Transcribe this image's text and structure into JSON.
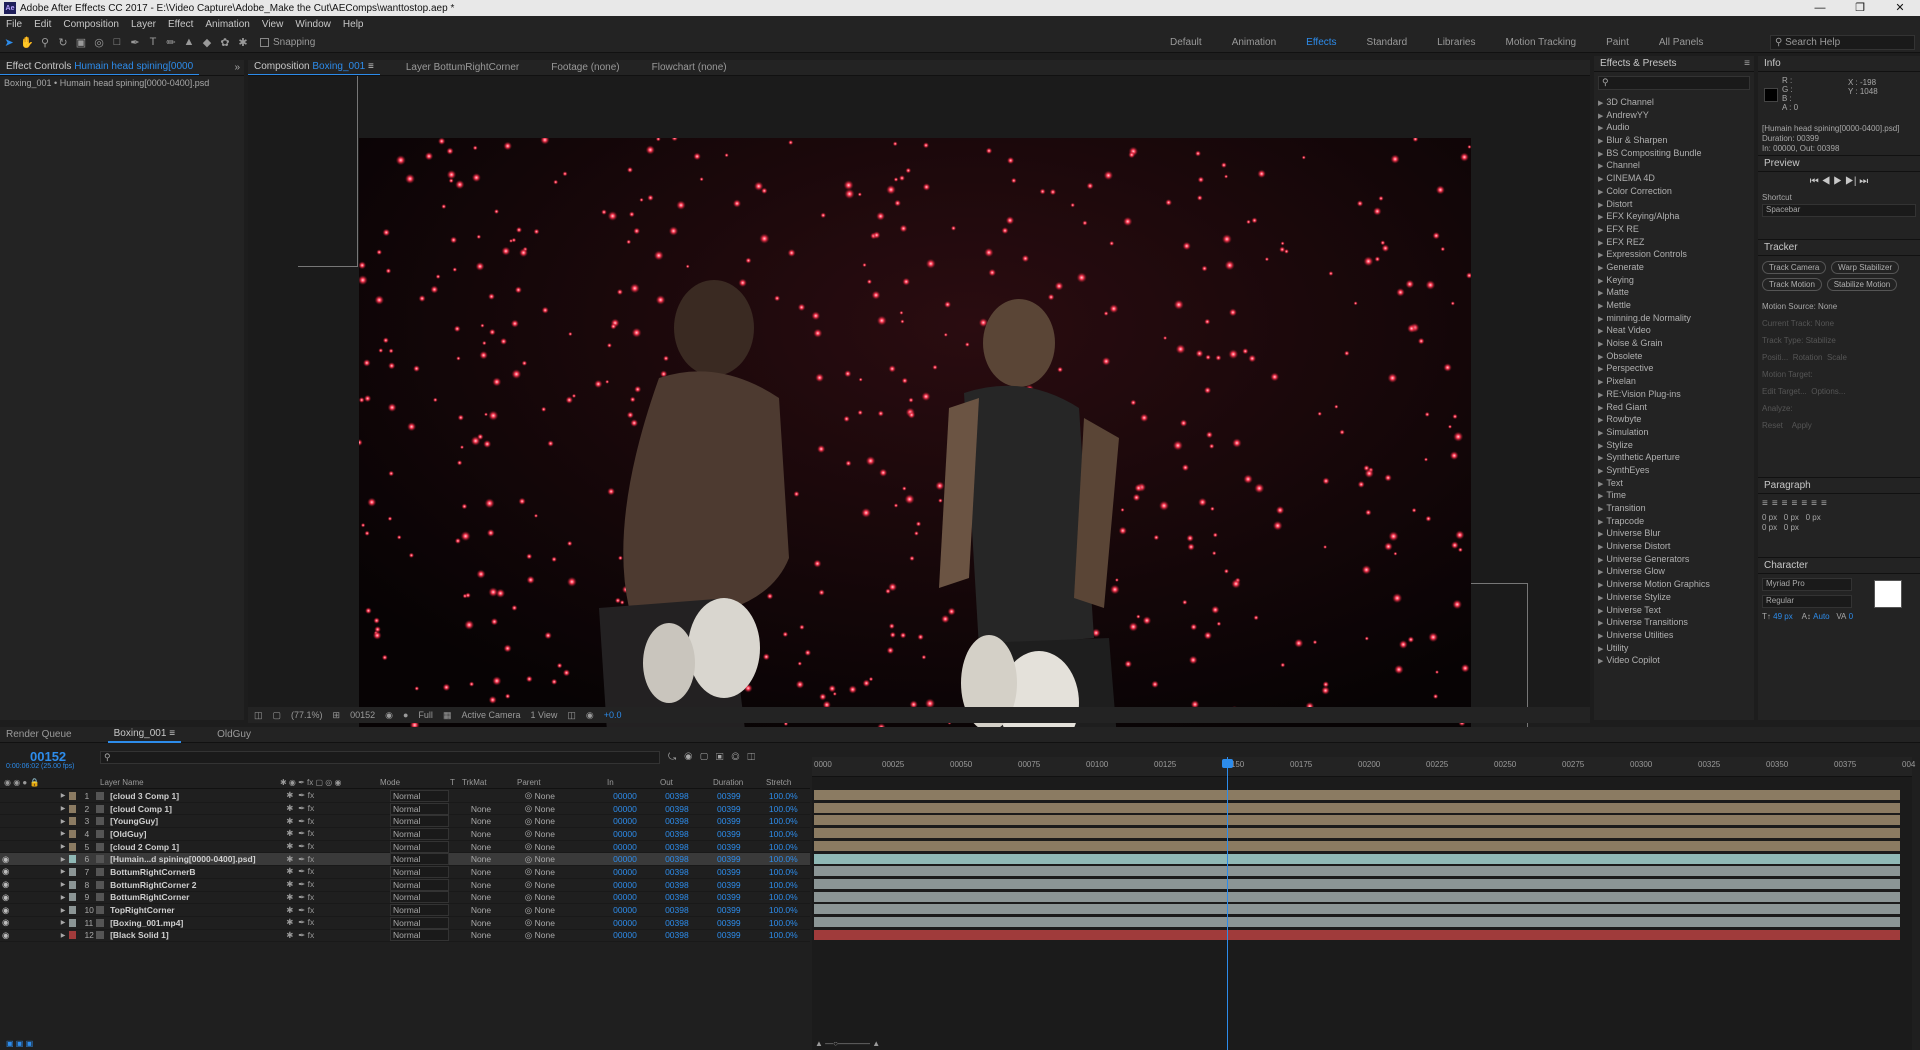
{
  "app": {
    "title": "Adobe After Effects CC 2017 - E:\\Video Capture\\Adobe_Make the Cut\\AEComps\\wanttostop.aep *",
    "logo": "Ae"
  },
  "menu": [
    "File",
    "Edit",
    "Composition",
    "Layer",
    "Effect",
    "Animation",
    "View",
    "Window",
    "Help"
  ],
  "toolbar": {
    "snapping": "Snapping",
    "workspaces": [
      "Default",
      "Animation",
      "Effects",
      "Standard",
      "Libraries",
      "Motion Tracking",
      "Paint",
      "All Panels"
    ],
    "active_workspace": "Effects",
    "search_help": "Search Help"
  },
  "left_panel": {
    "tab_prefix": "Effect Controls",
    "tab_layer": "Humain head spining[0000",
    "subtitle": "Boxing_001 • Humain head spining[0000-0400].psd"
  },
  "comp_panel": {
    "tab_prefix": "Composition",
    "tab_name": "Boxing_001",
    "tab_layer": "Layer BottumRightCorner",
    "tab_footage": "Footage (none)",
    "tab_flowchart": "Flowchart (none)"
  },
  "comp_footer": {
    "zoom": "(77.1%)",
    "timecode": "00152",
    "resolution": "Full",
    "camera": "Active Camera",
    "views": "1 View",
    "exposure": "+0.0"
  },
  "effects_panel": {
    "title": "Effects & Presets",
    "items": [
      "3D Channel",
      "AndrewYY",
      "Audio",
      "Blur & Sharpen",
      "BS Compositing Bundle",
      "Channel",
      "CINEMA 4D",
      "Color Correction",
      "Distort",
      "EFX Keying/Alpha",
      "EFX RE",
      "EFX REZ",
      "Expression Controls",
      "Generate",
      "Keying",
      "Matte",
      "Mettle",
      "minning.de Normality",
      "Neat Video",
      "Noise & Grain",
      "Obsolete",
      "Perspective",
      "Pixelan",
      "RE:Vision Plug-ins",
      "Red Giant",
      "Rowbyte",
      "Simulation",
      "Stylize",
      "Synthetic Aperture",
      "SynthEyes",
      "Text",
      "Time",
      "Transition",
      "Trapcode",
      "Universe Blur",
      "Universe Distort",
      "Universe Generators",
      "Universe Glow",
      "Universe Motion Graphics",
      "Universe Stylize",
      "Universe Text",
      "Universe Transitions",
      "Universe Utilities",
      "Utility",
      "Video Copilot"
    ]
  },
  "info_panel": {
    "title": "Info",
    "r": "R :",
    "g": "G :",
    "b": "B :",
    "a": "A : 0",
    "x": "X : -198",
    "y": "Y : 1048",
    "layer": "[Humain head spining[0000-0400].psd]",
    "duration": "Duration: 00399",
    "inout": "In: 00000, Out: 00398"
  },
  "preview": {
    "title": "Preview",
    "shortcut_label": "Shortcut",
    "shortcut_value": "Spacebar"
  },
  "tracker": {
    "title": "Tracker",
    "track_camera": "Track Camera",
    "warp_stabilizer": "Warp Stabilizer",
    "track_motion": "Track Motion",
    "stabilize_motion": "Stabilize Motion",
    "motion_source_label": "Motion Source:",
    "motion_source_value": "None",
    "current_track": "Current Track:",
    "current_track_value": "None",
    "track_type": "Track Type:",
    "track_type_value": "Stabilize",
    "position": "Positi...",
    "rotation": "Rotation",
    "scale": "Scale",
    "motion_target": "Motion Target:",
    "edit_target": "Edit Target...",
    "options": "Options...",
    "analyze": "Analyze:",
    "reset": "Reset",
    "apply": "Apply"
  },
  "paragraph": {
    "title": "Paragraph",
    "v1": "0 px",
    "v2": "0 px",
    "v3": "0 px",
    "v4": "0 px",
    "v5": "0 px"
  },
  "character": {
    "title": "Character",
    "font": "Myriad Pro",
    "style": "Regular",
    "size": "49 px",
    "leading": "Auto",
    "tracking": "0"
  },
  "timeline": {
    "tab_render": "Render Queue",
    "tab_comp": "Boxing_001",
    "tab_old": "OldGuy",
    "timecode": "00152",
    "sub_timecode": "0:00:06:02 (25.00 fps)",
    "headers": {
      "name": "Layer Name",
      "mode": "Mode",
      "t": "T",
      "trkmat": "TrkMat",
      "parent": "Parent",
      "in": "In",
      "out": "Out",
      "duration": "Duration",
      "stretch": "Stretch"
    },
    "ruler": [
      "0000",
      "00025",
      "00050",
      "00075",
      "00100",
      "00125",
      "00150",
      "00175",
      "00200",
      "00225",
      "00250",
      "00275",
      "00300",
      "00325",
      "00350",
      "00375",
      "004"
    ],
    "layers": [
      {
        "num": "1",
        "name": "[cloud 3 Comp 1]",
        "mode": "Normal",
        "trk": "",
        "parent": "None",
        "in": "00000",
        "out": "00398",
        "dur": "00399",
        "stretch": "100.0%",
        "color": "#8b7b62"
      },
      {
        "num": "2",
        "name": "[cloud Comp 1]",
        "mode": "Normal",
        "trk": "None",
        "parent": "None",
        "in": "00000",
        "out": "00398",
        "dur": "00399",
        "stretch": "100.0%",
        "color": "#8b7b62"
      },
      {
        "num": "3",
        "name": "[YoungGuy]",
        "mode": "Normal",
        "trk": "None",
        "parent": "None",
        "in": "00000",
        "out": "00398",
        "dur": "00399",
        "stretch": "100.0%",
        "color": "#8b7b62"
      },
      {
        "num": "4",
        "name": "[OldGuy]",
        "mode": "Normal",
        "trk": "None",
        "parent": "None",
        "in": "00000",
        "out": "00398",
        "dur": "00399",
        "stretch": "100.0%",
        "color": "#8b7b62"
      },
      {
        "num": "5",
        "name": "[cloud 2 Comp 1]",
        "mode": "Normal",
        "trk": "None",
        "parent": "None",
        "in": "00000",
        "out": "00398",
        "dur": "00399",
        "stretch": "100.0%",
        "color": "#8b7b62"
      },
      {
        "num": "6",
        "name": "[Humain...d spining[0000-0400].psd]",
        "mode": "Normal",
        "trk": "None",
        "parent": "None",
        "in": "00000",
        "out": "00398",
        "dur": "00399",
        "stretch": "100.0%",
        "color": "#8fb8b5"
      },
      {
        "num": "7",
        "name": "BottumRightCornerB",
        "mode": "Normal",
        "trk": "None",
        "parent": "None",
        "in": "00000",
        "out": "00398",
        "dur": "00399",
        "stretch": "100.0%",
        "color": "#8b9595"
      },
      {
        "num": "8",
        "name": "BottumRightCorner 2",
        "mode": "Normal",
        "trk": "None",
        "parent": "None",
        "in": "00000",
        "out": "00398",
        "dur": "00399",
        "stretch": "100.0%",
        "color": "#8b9595"
      },
      {
        "num": "9",
        "name": "BottumRightCorner",
        "mode": "Normal",
        "trk": "None",
        "parent": "None",
        "in": "00000",
        "out": "00398",
        "dur": "00399",
        "stretch": "100.0%",
        "color": "#8b9595"
      },
      {
        "num": "10",
        "name": "TopRightCorner",
        "mode": "Normal",
        "trk": "None",
        "parent": "None",
        "in": "00000",
        "out": "00398",
        "dur": "00399",
        "stretch": "100.0%",
        "color": "#8b9595"
      },
      {
        "num": "11",
        "name": "[Boxing_001.mp4]",
        "mode": "Normal",
        "trk": "None",
        "parent": "None",
        "in": "00000",
        "out": "00398",
        "dur": "00399",
        "stretch": "100.0%",
        "color": "#8b9595"
      },
      {
        "num": "12",
        "name": "[Black Solid 1]",
        "mode": "Normal",
        "trk": "None",
        "parent": "None",
        "in": "00000",
        "out": "00398",
        "dur": "00399",
        "stretch": "100.0%",
        "color": "#a03b3b"
      }
    ]
  },
  "colors": {
    "accent": "#2d8ceb",
    "panel": "#232323",
    "bg": "#1d1d1d"
  }
}
